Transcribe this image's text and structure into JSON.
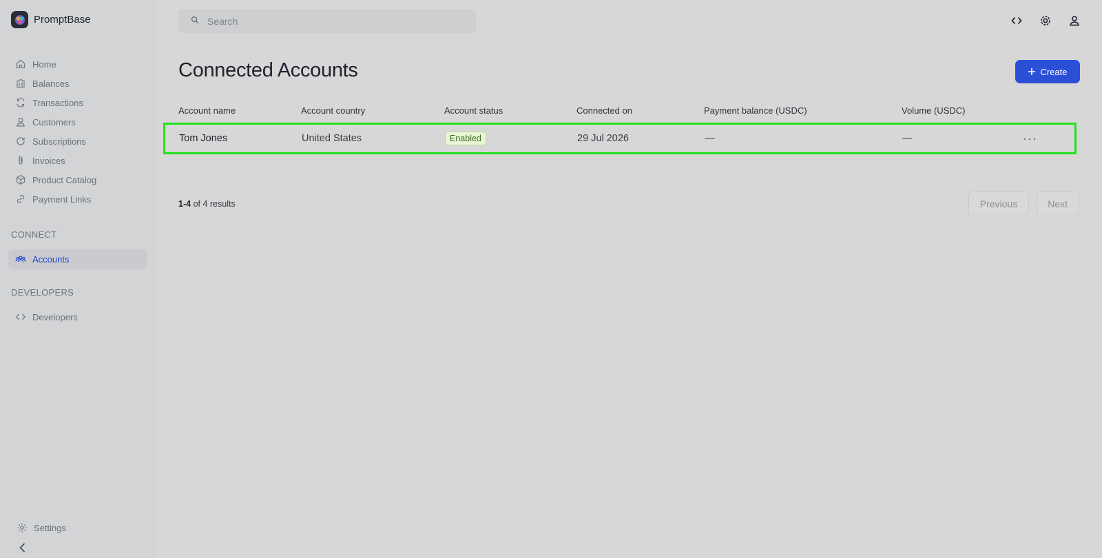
{
  "brand": {
    "name": "PromptBase"
  },
  "sidebar": {
    "items": [
      {
        "label": "Home",
        "icon": "home-icon"
      },
      {
        "label": "Balances",
        "icon": "bank-icon"
      },
      {
        "label": "Transactions",
        "icon": "refresh-icon"
      },
      {
        "label": "Customers",
        "icon": "user-icon"
      },
      {
        "label": "Subscriptions",
        "icon": "rotate-icon"
      },
      {
        "label": "Invoices",
        "icon": "paperclip-icon"
      },
      {
        "label": "Product Catalog",
        "icon": "box-icon"
      },
      {
        "label": "Payment Links",
        "icon": "link-icon"
      }
    ],
    "sections": {
      "connect": {
        "title": "CONNECT",
        "items": [
          {
            "label": "Accounts",
            "icon": "users-icon",
            "active": true
          }
        ]
      },
      "developers": {
        "title": "DEVELOPERS",
        "items": [
          {
            "label": "Developers",
            "icon": "code-icon"
          }
        ]
      }
    },
    "bottom": {
      "settings_label": "Settings"
    },
    "colors": {
      "active": "#2348d3"
    }
  },
  "search": {
    "placeholder": "Search"
  },
  "header": {
    "icons": [
      "code-icon",
      "gear-icon",
      "user-icon"
    ]
  },
  "page": {
    "title": "Connected Accounts",
    "create_label": "Create"
  },
  "table": {
    "columns": [
      "Account name",
      "Account country",
      "Account status",
      "Connected on",
      "Payment balance (USDC)",
      "Volume (USDC)"
    ],
    "rows": [
      {
        "name": "Tom Jones",
        "country": "United States",
        "status": "Enabled",
        "connected_on": "29 Jul 2026",
        "payment_balance": "—",
        "volume": "—"
      }
    ]
  },
  "pagination": {
    "range": "1-4",
    "suffix": "of 4 results",
    "previous_label": "Previous",
    "next_label": "Next"
  },
  "colors": {
    "primary": "#2c4fd8",
    "highlight": "#22e31b",
    "badge_text": "#3b6b1f"
  }
}
